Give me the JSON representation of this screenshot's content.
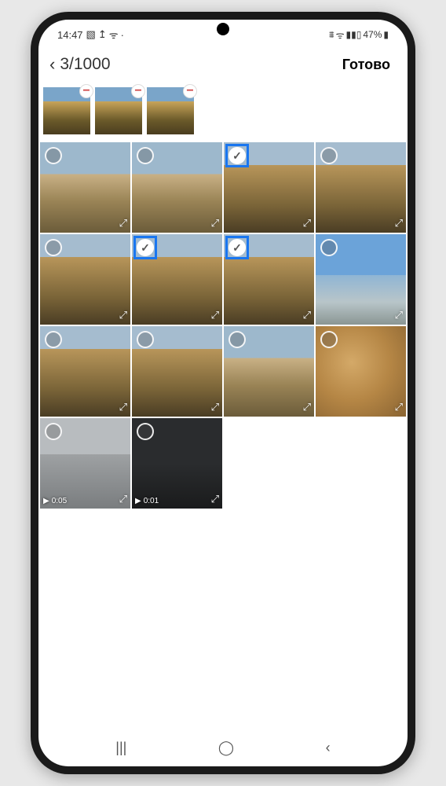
{
  "status": {
    "time": "14:47",
    "battery_text": "47%"
  },
  "header": {
    "counter": "3/1000",
    "done_label": "Готово"
  },
  "strip": [
    {
      "remove": "−"
    },
    {
      "remove": "−"
    },
    {
      "remove": "−"
    }
  ],
  "grid": [
    {
      "style": "sky-city",
      "selected": false,
      "video": null
    },
    {
      "style": "sky-city",
      "selected": false,
      "video": null
    },
    {
      "style": "sky-trees",
      "selected": true,
      "video": null
    },
    {
      "style": "sky-trees",
      "selected": false,
      "video": null
    },
    {
      "style": "sky-trees",
      "selected": false,
      "video": null
    },
    {
      "style": "sky-trees",
      "selected": true,
      "video": null
    },
    {
      "style": "sky-trees",
      "selected": true,
      "video": null
    },
    {
      "style": "sky-bright",
      "selected": false,
      "video": null
    },
    {
      "style": "sky-trees",
      "selected": false,
      "video": null
    },
    {
      "style": "sky-trees",
      "selected": false,
      "video": null
    },
    {
      "style": "sky-city",
      "selected": false,
      "video": null
    },
    {
      "style": "plush",
      "selected": false,
      "video": null
    },
    {
      "style": "foggy",
      "selected": false,
      "video": "0:05"
    },
    {
      "style": "dark-int",
      "selected": false,
      "video": "0:01"
    }
  ]
}
